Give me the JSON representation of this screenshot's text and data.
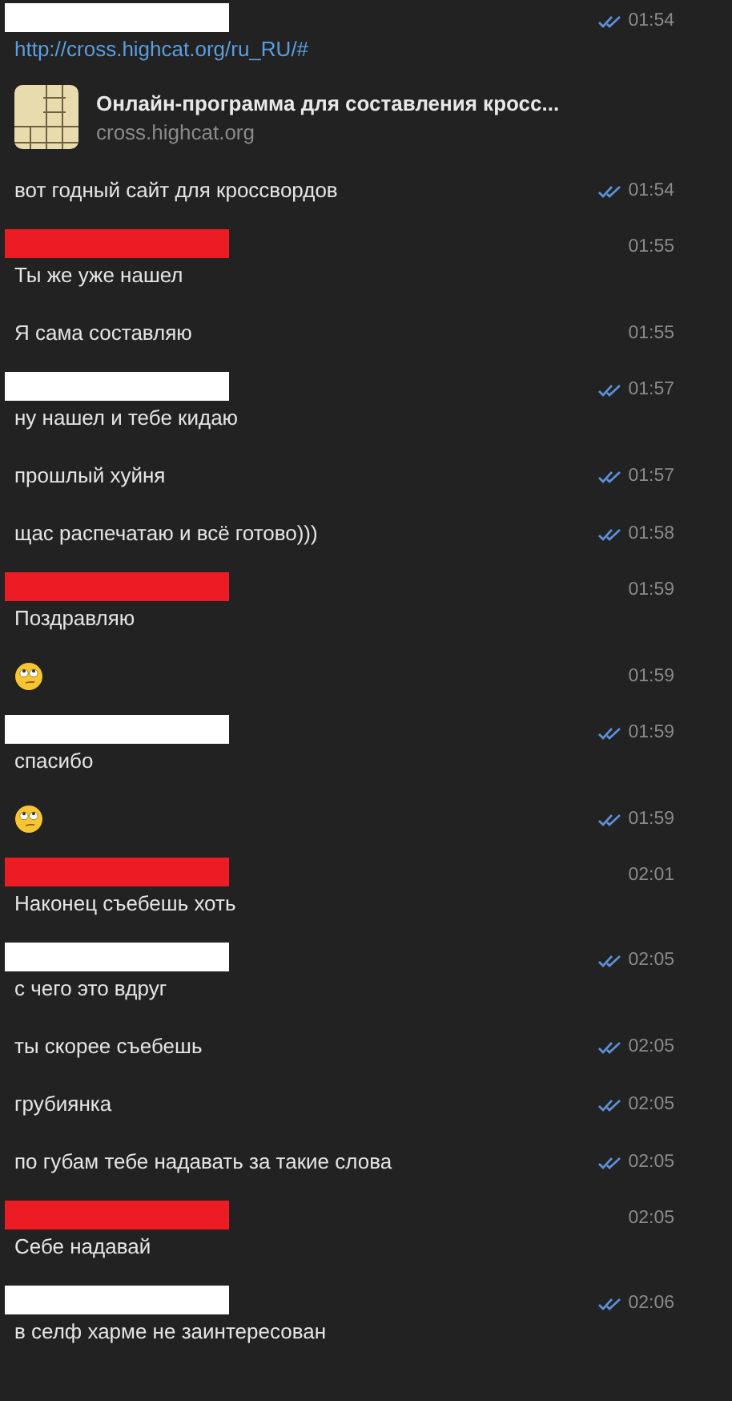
{
  "messages": [
    {
      "kind": "link",
      "color": "#ffffff",
      "read": true,
      "time": "01:54",
      "url": "http://cross.highcat.org/ru_RU/#",
      "preview": {
        "title": "Онлайн-программа для составления кросс...",
        "domain": "cross.highcat.org"
      }
    },
    {
      "kind": "text",
      "read": true,
      "time": "01:54",
      "text": "вот годный сайт для кроссвордов"
    },
    {
      "kind": "text",
      "color": "#ed1c24",
      "read": false,
      "time": "01:55",
      "text": "Ты же уже нашел"
    },
    {
      "kind": "text",
      "read": false,
      "time": "01:55",
      "text": "Я сама составляю"
    },
    {
      "kind": "text",
      "color": "#ffffff",
      "read": true,
      "time": "01:57",
      "text": "ну нашел и тебе кидаю"
    },
    {
      "kind": "text",
      "read": true,
      "time": "01:57",
      "text": "прошлый хуйня"
    },
    {
      "kind": "text",
      "read": true,
      "time": "01:58",
      "text": "щас распечатаю и всё готово)))"
    },
    {
      "kind": "text",
      "color": "#ed1c24",
      "read": false,
      "time": "01:59",
      "text": "Поздравляю"
    },
    {
      "kind": "emoji",
      "read": false,
      "time": "01:59"
    },
    {
      "kind": "text",
      "color": "#ffffff",
      "read": true,
      "time": "01:59",
      "text": "спасибо"
    },
    {
      "kind": "emoji",
      "read": true,
      "time": "01:59"
    },
    {
      "kind": "text",
      "color": "#ed1c24",
      "read": false,
      "time": "02:01",
      "text": "Наконец съебешь хоть"
    },
    {
      "kind": "text",
      "color": "#ffffff",
      "read": true,
      "time": "02:05",
      "text": "с чего это вдруг"
    },
    {
      "kind": "text",
      "read": true,
      "time": "02:05",
      "text": "ты скорее съебешь"
    },
    {
      "kind": "text",
      "read": true,
      "time": "02:05",
      "text": "грубиянка"
    },
    {
      "kind": "text",
      "read": true,
      "time": "02:05",
      "text": "по губам тебе надавать за такие слова"
    },
    {
      "kind": "text",
      "color": "#ed1c24",
      "read": false,
      "time": "02:05",
      "text": "Себе надавай"
    },
    {
      "kind": "text",
      "color": "#ffffff",
      "read": true,
      "time": "02:06",
      "text": "в селф харме не заинтересован"
    }
  ]
}
